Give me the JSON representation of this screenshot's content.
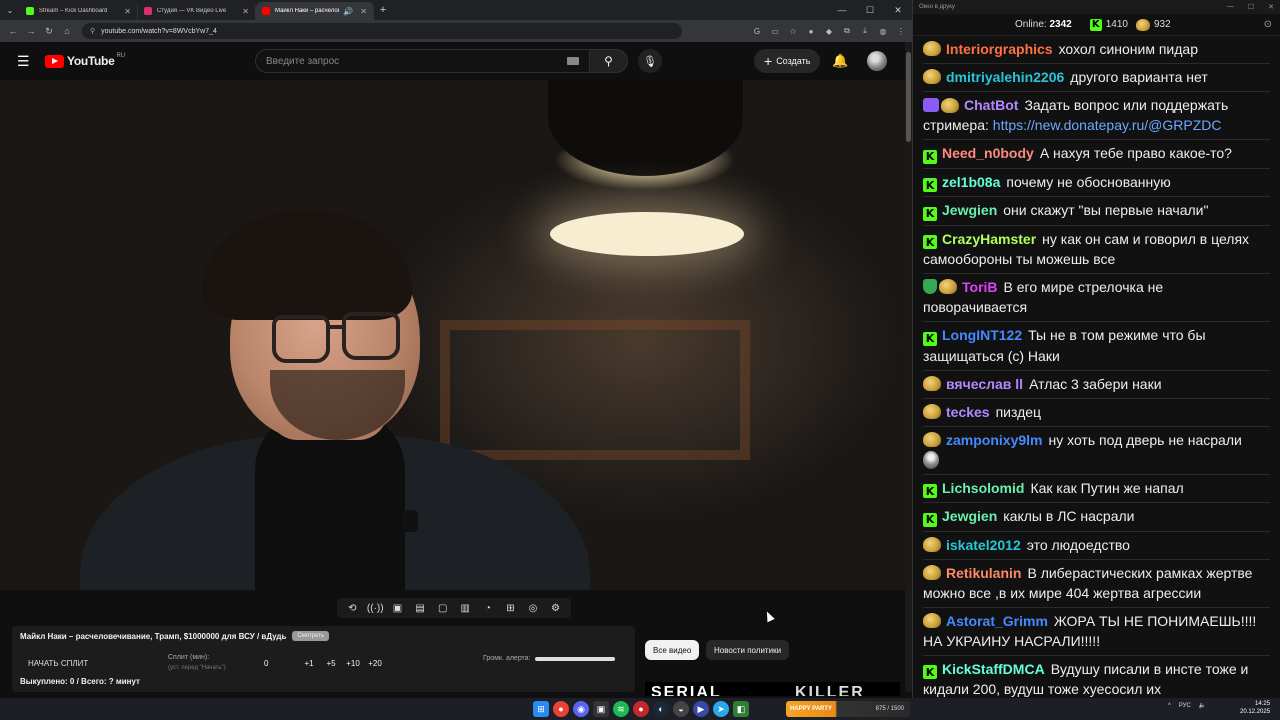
{
  "browser": {
    "tabs": [
      {
        "title": "Stream – Kick Dashboard",
        "color": "#53fc18",
        "active": false
      },
      {
        "title": "Студия — VK Видео Live",
        "color": "#e02e6a",
        "active": false
      },
      {
        "title": "Майкл Наки – расчеловечи",
        "color": "#ff0000",
        "active": true
      }
    ],
    "url": "youtube.com/watch?v=8WVcbYw7_4"
  },
  "youtube": {
    "logo_word": "YouTube",
    "region": "RU",
    "search_placeholder": "Введите запрос",
    "create_label": "Создать"
  },
  "extension": {
    "video_title": "Майкл Наки – расчеловечивание, Трамп, $1000000 для ВСУ / вДудь",
    "badge": "Смотреть",
    "start_split": "НАЧАТЬ СПЛИТ",
    "split_label": "Сплит (мин):",
    "split_sub": "(уст. перед \"Начать\")",
    "split_value": "0",
    "steps": [
      "+1",
      "+5",
      "+10",
      "+20"
    ],
    "alert_volume": "Громк. алерта:",
    "bought": "Выкуплено: 0 / Всего: ? минут"
  },
  "chips": {
    "all": "Все видео",
    "politics": "Новости политики"
  },
  "rec_thumb": {
    "left": "SERIAL",
    "right": "KILLER"
  },
  "chat": {
    "window_title": "Окно в друку",
    "online_label": "Online:",
    "online_count": "2342",
    "kick_count": "1410",
    "yt_count": "932",
    "messages": [
      {
        "badges": [
          "yt"
        ],
        "user": "Interiorgraphics",
        "color": "#ff7043",
        "text": "хохол синоним пидар"
      },
      {
        "badges": [
          "yt"
        ],
        "user": "dmitriyalehin2206",
        "color": "#26c6da",
        "text": "другого варианта нет"
      },
      {
        "badges": [
          "bot",
          "yt"
        ],
        "user": "ChatBot",
        "color": "#b388ff",
        "text": "Задать вопрос или поддержать стримера: ",
        "link": "https://new.donatepay.ru/@GRPZDC"
      },
      {
        "badges": [
          "kick"
        ],
        "user": "Need_n0body",
        "color": "#ff8a80",
        "text": "А нахуя тебе право какое-то?"
      },
      {
        "badges": [
          "kick"
        ],
        "user": "zel1b08a",
        "color": "#64ffda",
        "text": "почему не обоснованную"
      },
      {
        "badges": [
          "kick"
        ],
        "user": "Jewgien",
        "color": "#69f0ae",
        "text": "они скажут \"вы первые начали\""
      },
      {
        "badges": [
          "kick"
        ],
        "user": "CrazyHamster",
        "color": "#b2ff59",
        "text": "ну как он сам и говорил в целях самообороны ты можешь все"
      },
      {
        "badges": [
          "shield",
          "yt"
        ],
        "user": "ToriB",
        "color": "#e040fb",
        "text": "В его мире стрелочка не поворачивается"
      },
      {
        "badges": [
          "kick"
        ],
        "user": "LongINT122",
        "color": "#448aff",
        "text": "Ты не в том режиме что бы защищаться (с) Наки"
      },
      {
        "badges": [
          "yt"
        ],
        "user": "вячеслав ll",
        "color": "#b388ff",
        "text": "Атлас 3 забери наки"
      },
      {
        "badges": [
          "yt"
        ],
        "user": "teckes",
        "color": "#b388ff",
        "text": "пиздец"
      },
      {
        "badges": [
          "yt"
        ],
        "user": "zamponixy9lm",
        "color": "#448aff",
        "text": "ну хоть под дверь не насрали",
        "avatar_inline": true
      },
      {
        "badges": [
          "kick"
        ],
        "user": "Lichsolomid",
        "color": "#69f0ae",
        "text": "Как как Путин же напал"
      },
      {
        "badges": [
          "kick"
        ],
        "user": "Jewgien",
        "color": "#69f0ae",
        "text": "каклы в ЛС насрали"
      },
      {
        "badges": [
          "yt"
        ],
        "user": "iskatel2012",
        "color": "#26c6da",
        "text": "это людоедство"
      },
      {
        "badges": [
          "yt"
        ],
        "user": "Retikulanin",
        "color": "#ff8a65",
        "text": "В либерастических рамках жертве можно все ,в их мире 404 жертва агрессии"
      },
      {
        "badges": [
          "yt"
        ],
        "user": "Astorat_Grimm",
        "color": "#448aff",
        "text": "ЖОРА ТЫ НЕ ПОНИМАЕШЬ!!!! НА УКРАИНУ НАСРАЛИ!!!!!"
      },
      {
        "badges": [
          "kick"
        ],
        "user": "KickStaffDMCA",
        "color": "#64ffda",
        "text": "Вудушу писали в инсте тоже и кидали 200, вудуш тоже хуесосил их"
      }
    ]
  },
  "taskbar": {
    "banner_left": "HAPPY PARTY",
    "banner_right": "875 / 1500",
    "lang": "РУС",
    "time": "14:25",
    "date": "20.12.2025"
  },
  "colors": {
    "kick_green": "#53fc18",
    "youtube_red": "#ff0000"
  }
}
